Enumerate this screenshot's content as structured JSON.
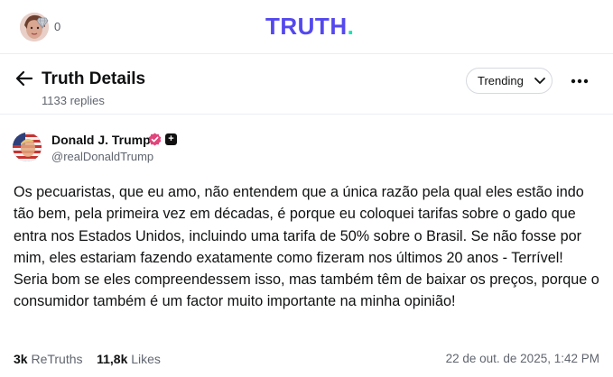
{
  "header": {
    "logo": "TRUTH",
    "logo_dot": ".",
    "gem_count": "0",
    "colors": {
      "logo": "#5448ee",
      "logo_dot": "#17e3b5"
    }
  },
  "page": {
    "title": "Truth Details",
    "replies": "1133 replies",
    "sort_label": "Trending"
  },
  "post": {
    "author_name": "Donald J. Trump",
    "author_handle": "@realDonaldTrump",
    "text": "Os pecuaristas, que eu amo, não entendem que a única razão pela qual eles estão indo tão bem, pela primeira vez em décadas, é porque eu coloquei tarifas sobre o gado que entra nos Estados Unidos, incluindo uma tarifa de 50% sobre o Brasil. Se não fosse por mim, eles estariam fazendo exatamente como fizeram nos últimos 20 anos - Terrível! Seria bom se eles compreendessem isso, mas também têm de baixar os preços, porque o consumidor também é um factor muito importante na minha opinião!",
    "retruths_count": "3k",
    "retruths_label": "ReTruths",
    "likes_count": "11,8k",
    "likes_label": "Likes",
    "timestamp": "22 de out. de 2025, 1:42 PM",
    "colors": {
      "verified": "#e0457b"
    }
  },
  "icons": {
    "back": "arrow-left-icon",
    "sort": "chevron-down-icon",
    "more": "more-horizontal-icon",
    "verified": "verified-badge-icon",
    "plus": "plus-badge-icon",
    "gem": "gem-icon"
  }
}
